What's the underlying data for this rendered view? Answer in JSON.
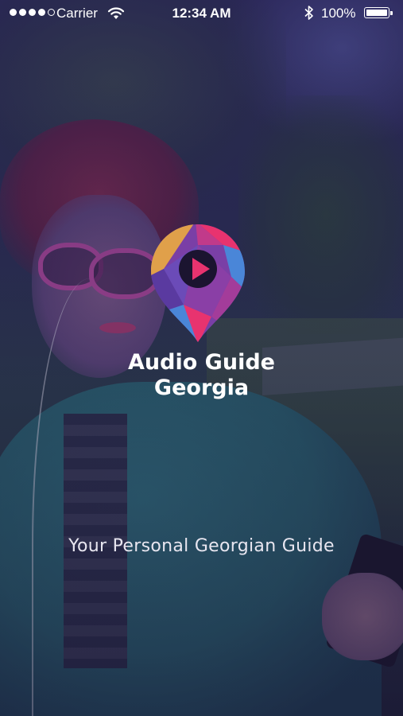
{
  "status_bar": {
    "carrier": "Carrier",
    "time": "12:34 AM",
    "battery": "100%",
    "signal_bars_filled": 4,
    "signal_bars_total": 5
  },
  "splash": {
    "app_name_line1": "Audio Guide",
    "app_name_line2": "Georgia",
    "tagline": "Your Personal Georgian Guide"
  },
  "icons": {
    "logo": "map-pin-play-icon",
    "wifi": "wifi-icon",
    "bluetooth": "bluetooth-icon",
    "battery": "battery-icon"
  },
  "colors": {
    "logo_pink": "#e8336f",
    "logo_purple": "#7a3fa6",
    "logo_blue": "#4a86d8",
    "logo_orange": "#f08a3c",
    "overlay": "#2a2260"
  }
}
